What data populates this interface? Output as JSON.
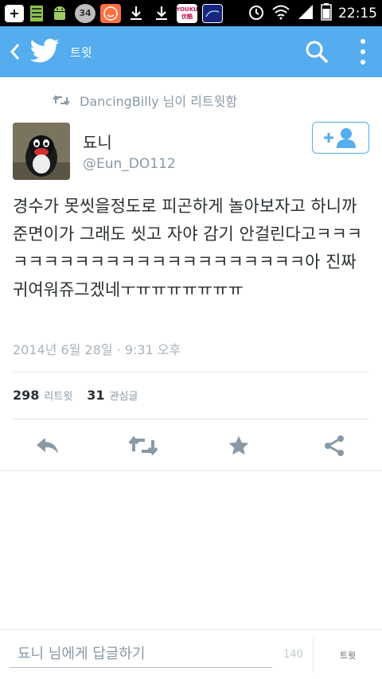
{
  "status_bar": {
    "time": "22:15",
    "notif_icons": [
      "plus-icon",
      "memory-icon",
      "android-icon",
      "counter-icon",
      "smiley-app-icon",
      "download-icon",
      "download-icon",
      "youku-icon",
      "wallpaper-icon"
    ],
    "counter_badge": "34",
    "youku_label": "YOUKU 优酷"
  },
  "app_bar": {
    "title": "트윗",
    "color": "#55acee"
  },
  "retweet_context": {
    "text": "DancingBilly 님이 리트윗함"
  },
  "tweet": {
    "author_name": "됴니",
    "author_handle": "@Eun_DO112",
    "text": "경수가 못씻을정도로 피곤하게 놀아보자고 하니까 준면이가 그래도 씻고 자야 감기 안걸린다고ㅋㅋㅋㅋㅋㅋㅋㅋㅋㅋㅋㅋㅋㅋㅋㅋㅋㅋㅋㅋㅋㅋ아 진짜 귀여워쥬그겠네ㅜㅠㅠㅠㅠㅠㅠㅠ",
    "timestamp": "2014년 6월 28일 · 9:31 오후",
    "retweet_count": "298",
    "retweet_label": "리트윗",
    "favorite_count": "31",
    "favorite_label": "관심글"
  },
  "actions": [
    "reply-icon",
    "retweet-icon",
    "favorite-icon",
    "share-icon"
  ],
  "reply_bar": {
    "placeholder": "됴니 님에게 답글하기",
    "char_count": "140",
    "tweet_button": "트윗"
  }
}
